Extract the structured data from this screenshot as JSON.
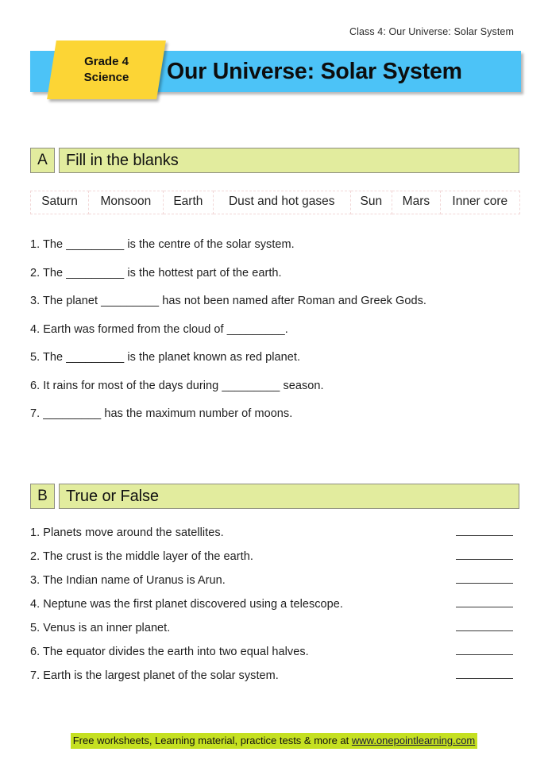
{
  "running_head": "Class 4: Our Universe: Solar System",
  "banner": {
    "badge_line1": "Grade 4",
    "badge_line2": "Science",
    "title": "Our Universe: Solar System",
    "bar_color": "#4cc3f7",
    "badge_color": "#fcd535"
  },
  "sections": [
    {
      "letter": "A",
      "title": "Fill in the blanks",
      "header_color": "#e2ec9e"
    },
    {
      "letter": "B",
      "title": "True or False",
      "header_color": "#e2ec9e"
    }
  ],
  "word_bank": [
    "Saturn",
    "Monsoon",
    "Earth",
    "Dust and hot gases",
    "Sun",
    "Mars",
    "Inner core"
  ],
  "fill_in_the_blanks": [
    "1. The _________ is the centre of the solar system.",
    "2. The _________ is the hottest part of the earth.",
    "3. The planet _________ has not been named after Roman and Greek Gods.",
    "4. Earth was formed from the cloud of _________.",
    "5. The _________ is the planet known as red planet.",
    "6. It rains for most of the days during _________ season.",
    "7. _________ has the maximum number of moons."
  ],
  "true_or_false": [
    "1. Planets move around the satellites.",
    "2. The crust is the middle layer of the earth.",
    "3. The Indian name of Uranus is Arun.",
    "4. Neptune was the first planet discovered using a telescope.",
    "5. Venus is an inner planet.",
    "6. The equator divides the earth into two equal halves.",
    "7. Earth is the largest planet of the solar system."
  ],
  "footer": {
    "text": "Free worksheets, Learning material, practice tests & more at ",
    "link": "www.onepointlearning.com",
    "highlight_color": "#c5e021"
  }
}
